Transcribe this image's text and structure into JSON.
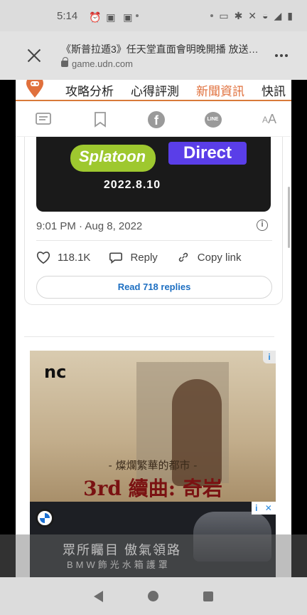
{
  "status_bar": {
    "time": "5:14"
  },
  "browser": {
    "page_title": "《斯普拉遁3》任天堂直面會明晚開播 放送…",
    "domain": "game.udn.com"
  },
  "site_nav": {
    "items": [
      "攻略分析",
      "心得評測",
      "新聞資訊",
      "快訊"
    ],
    "active_index": 2
  },
  "share_bar": {
    "font_size_label": "A",
    "font_size_small": "A",
    "line_label": "LINE",
    "facebook_label": "f"
  },
  "tweet": {
    "image_brand": "Splatoon",
    "image_badge": "Direct",
    "image_date": "2022.8.10",
    "timestamp": "9:01 PM · Aug 8, 2022",
    "likes": "118.1K",
    "reply_label": "Reply",
    "copy_link_label": "Copy link",
    "read_replies": "Read 718 replies"
  },
  "ad1": {
    "brand": "nc",
    "subtitle": "- 燦爛繁華的都市 -",
    "title": "3rd 續曲: 奇岩"
  },
  "ad2": {
    "title": "眾所矚目 傲氣領路",
    "subtitle": "BMW飾光水箱護罩"
  },
  "colors": {
    "accent": "#e0703c",
    "link": "#1d6fc2"
  }
}
